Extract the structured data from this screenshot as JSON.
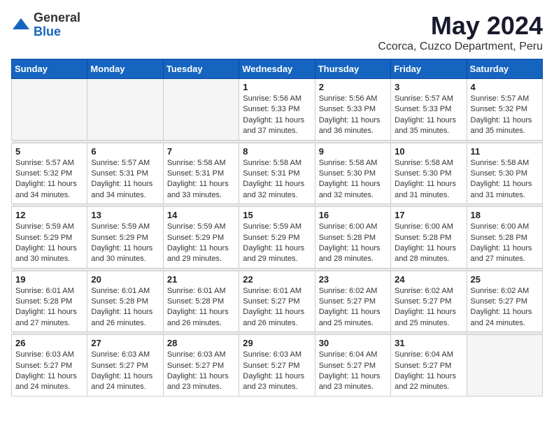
{
  "logo": {
    "general": "General",
    "blue": "Blue"
  },
  "title": "May 2024",
  "location": "Ccorca, Cuzco Department, Peru",
  "days_of_week": [
    "Sunday",
    "Monday",
    "Tuesday",
    "Wednesday",
    "Thursday",
    "Friday",
    "Saturday"
  ],
  "weeks": [
    [
      {
        "day": "",
        "sunrise": "",
        "sunset": "",
        "daylight": ""
      },
      {
        "day": "",
        "sunrise": "",
        "sunset": "",
        "daylight": ""
      },
      {
        "day": "",
        "sunrise": "",
        "sunset": "",
        "daylight": ""
      },
      {
        "day": "1",
        "sunrise": "Sunrise: 5:56 AM",
        "sunset": "Sunset: 5:33 PM",
        "daylight": "Daylight: 11 hours and 37 minutes."
      },
      {
        "day": "2",
        "sunrise": "Sunrise: 5:56 AM",
        "sunset": "Sunset: 5:33 PM",
        "daylight": "Daylight: 11 hours and 36 minutes."
      },
      {
        "day": "3",
        "sunrise": "Sunrise: 5:57 AM",
        "sunset": "Sunset: 5:33 PM",
        "daylight": "Daylight: 11 hours and 35 minutes."
      },
      {
        "day": "4",
        "sunrise": "Sunrise: 5:57 AM",
        "sunset": "Sunset: 5:32 PM",
        "daylight": "Daylight: 11 hours and 35 minutes."
      }
    ],
    [
      {
        "day": "5",
        "sunrise": "Sunrise: 5:57 AM",
        "sunset": "Sunset: 5:32 PM",
        "daylight": "Daylight: 11 hours and 34 minutes."
      },
      {
        "day": "6",
        "sunrise": "Sunrise: 5:57 AM",
        "sunset": "Sunset: 5:31 PM",
        "daylight": "Daylight: 11 hours and 34 minutes."
      },
      {
        "day": "7",
        "sunrise": "Sunrise: 5:58 AM",
        "sunset": "Sunset: 5:31 PM",
        "daylight": "Daylight: 11 hours and 33 minutes."
      },
      {
        "day": "8",
        "sunrise": "Sunrise: 5:58 AM",
        "sunset": "Sunset: 5:31 PM",
        "daylight": "Daylight: 11 hours and 32 minutes."
      },
      {
        "day": "9",
        "sunrise": "Sunrise: 5:58 AM",
        "sunset": "Sunset: 5:30 PM",
        "daylight": "Daylight: 11 hours and 32 minutes."
      },
      {
        "day": "10",
        "sunrise": "Sunrise: 5:58 AM",
        "sunset": "Sunset: 5:30 PM",
        "daylight": "Daylight: 11 hours and 31 minutes."
      },
      {
        "day": "11",
        "sunrise": "Sunrise: 5:58 AM",
        "sunset": "Sunset: 5:30 PM",
        "daylight": "Daylight: 11 hours and 31 minutes."
      }
    ],
    [
      {
        "day": "12",
        "sunrise": "Sunrise: 5:59 AM",
        "sunset": "Sunset: 5:29 PM",
        "daylight": "Daylight: 11 hours and 30 minutes."
      },
      {
        "day": "13",
        "sunrise": "Sunrise: 5:59 AM",
        "sunset": "Sunset: 5:29 PM",
        "daylight": "Daylight: 11 hours and 30 minutes."
      },
      {
        "day": "14",
        "sunrise": "Sunrise: 5:59 AM",
        "sunset": "Sunset: 5:29 PM",
        "daylight": "Daylight: 11 hours and 29 minutes."
      },
      {
        "day": "15",
        "sunrise": "Sunrise: 5:59 AM",
        "sunset": "Sunset: 5:29 PM",
        "daylight": "Daylight: 11 hours and 29 minutes."
      },
      {
        "day": "16",
        "sunrise": "Sunrise: 6:00 AM",
        "sunset": "Sunset: 5:28 PM",
        "daylight": "Daylight: 11 hours and 28 minutes."
      },
      {
        "day": "17",
        "sunrise": "Sunrise: 6:00 AM",
        "sunset": "Sunset: 5:28 PM",
        "daylight": "Daylight: 11 hours and 28 minutes."
      },
      {
        "day": "18",
        "sunrise": "Sunrise: 6:00 AM",
        "sunset": "Sunset: 5:28 PM",
        "daylight": "Daylight: 11 hours and 27 minutes."
      }
    ],
    [
      {
        "day": "19",
        "sunrise": "Sunrise: 6:01 AM",
        "sunset": "Sunset: 5:28 PM",
        "daylight": "Daylight: 11 hours and 27 minutes."
      },
      {
        "day": "20",
        "sunrise": "Sunrise: 6:01 AM",
        "sunset": "Sunset: 5:28 PM",
        "daylight": "Daylight: 11 hours and 26 minutes."
      },
      {
        "day": "21",
        "sunrise": "Sunrise: 6:01 AM",
        "sunset": "Sunset: 5:28 PM",
        "daylight": "Daylight: 11 hours and 26 minutes."
      },
      {
        "day": "22",
        "sunrise": "Sunrise: 6:01 AM",
        "sunset": "Sunset: 5:27 PM",
        "daylight": "Daylight: 11 hours and 26 minutes."
      },
      {
        "day": "23",
        "sunrise": "Sunrise: 6:02 AM",
        "sunset": "Sunset: 5:27 PM",
        "daylight": "Daylight: 11 hours and 25 minutes."
      },
      {
        "day": "24",
        "sunrise": "Sunrise: 6:02 AM",
        "sunset": "Sunset: 5:27 PM",
        "daylight": "Daylight: 11 hours and 25 minutes."
      },
      {
        "day": "25",
        "sunrise": "Sunrise: 6:02 AM",
        "sunset": "Sunset: 5:27 PM",
        "daylight": "Daylight: 11 hours and 24 minutes."
      }
    ],
    [
      {
        "day": "26",
        "sunrise": "Sunrise: 6:03 AM",
        "sunset": "Sunset: 5:27 PM",
        "daylight": "Daylight: 11 hours and 24 minutes."
      },
      {
        "day": "27",
        "sunrise": "Sunrise: 6:03 AM",
        "sunset": "Sunset: 5:27 PM",
        "daylight": "Daylight: 11 hours and 24 minutes."
      },
      {
        "day": "28",
        "sunrise": "Sunrise: 6:03 AM",
        "sunset": "Sunset: 5:27 PM",
        "daylight": "Daylight: 11 hours and 23 minutes."
      },
      {
        "day": "29",
        "sunrise": "Sunrise: 6:03 AM",
        "sunset": "Sunset: 5:27 PM",
        "daylight": "Daylight: 11 hours and 23 minutes."
      },
      {
        "day": "30",
        "sunrise": "Sunrise: 6:04 AM",
        "sunset": "Sunset: 5:27 PM",
        "daylight": "Daylight: 11 hours and 23 minutes."
      },
      {
        "day": "31",
        "sunrise": "Sunrise: 6:04 AM",
        "sunset": "Sunset: 5:27 PM",
        "daylight": "Daylight: 11 hours and 22 minutes."
      },
      {
        "day": "",
        "sunrise": "",
        "sunset": "",
        "daylight": ""
      }
    ]
  ]
}
